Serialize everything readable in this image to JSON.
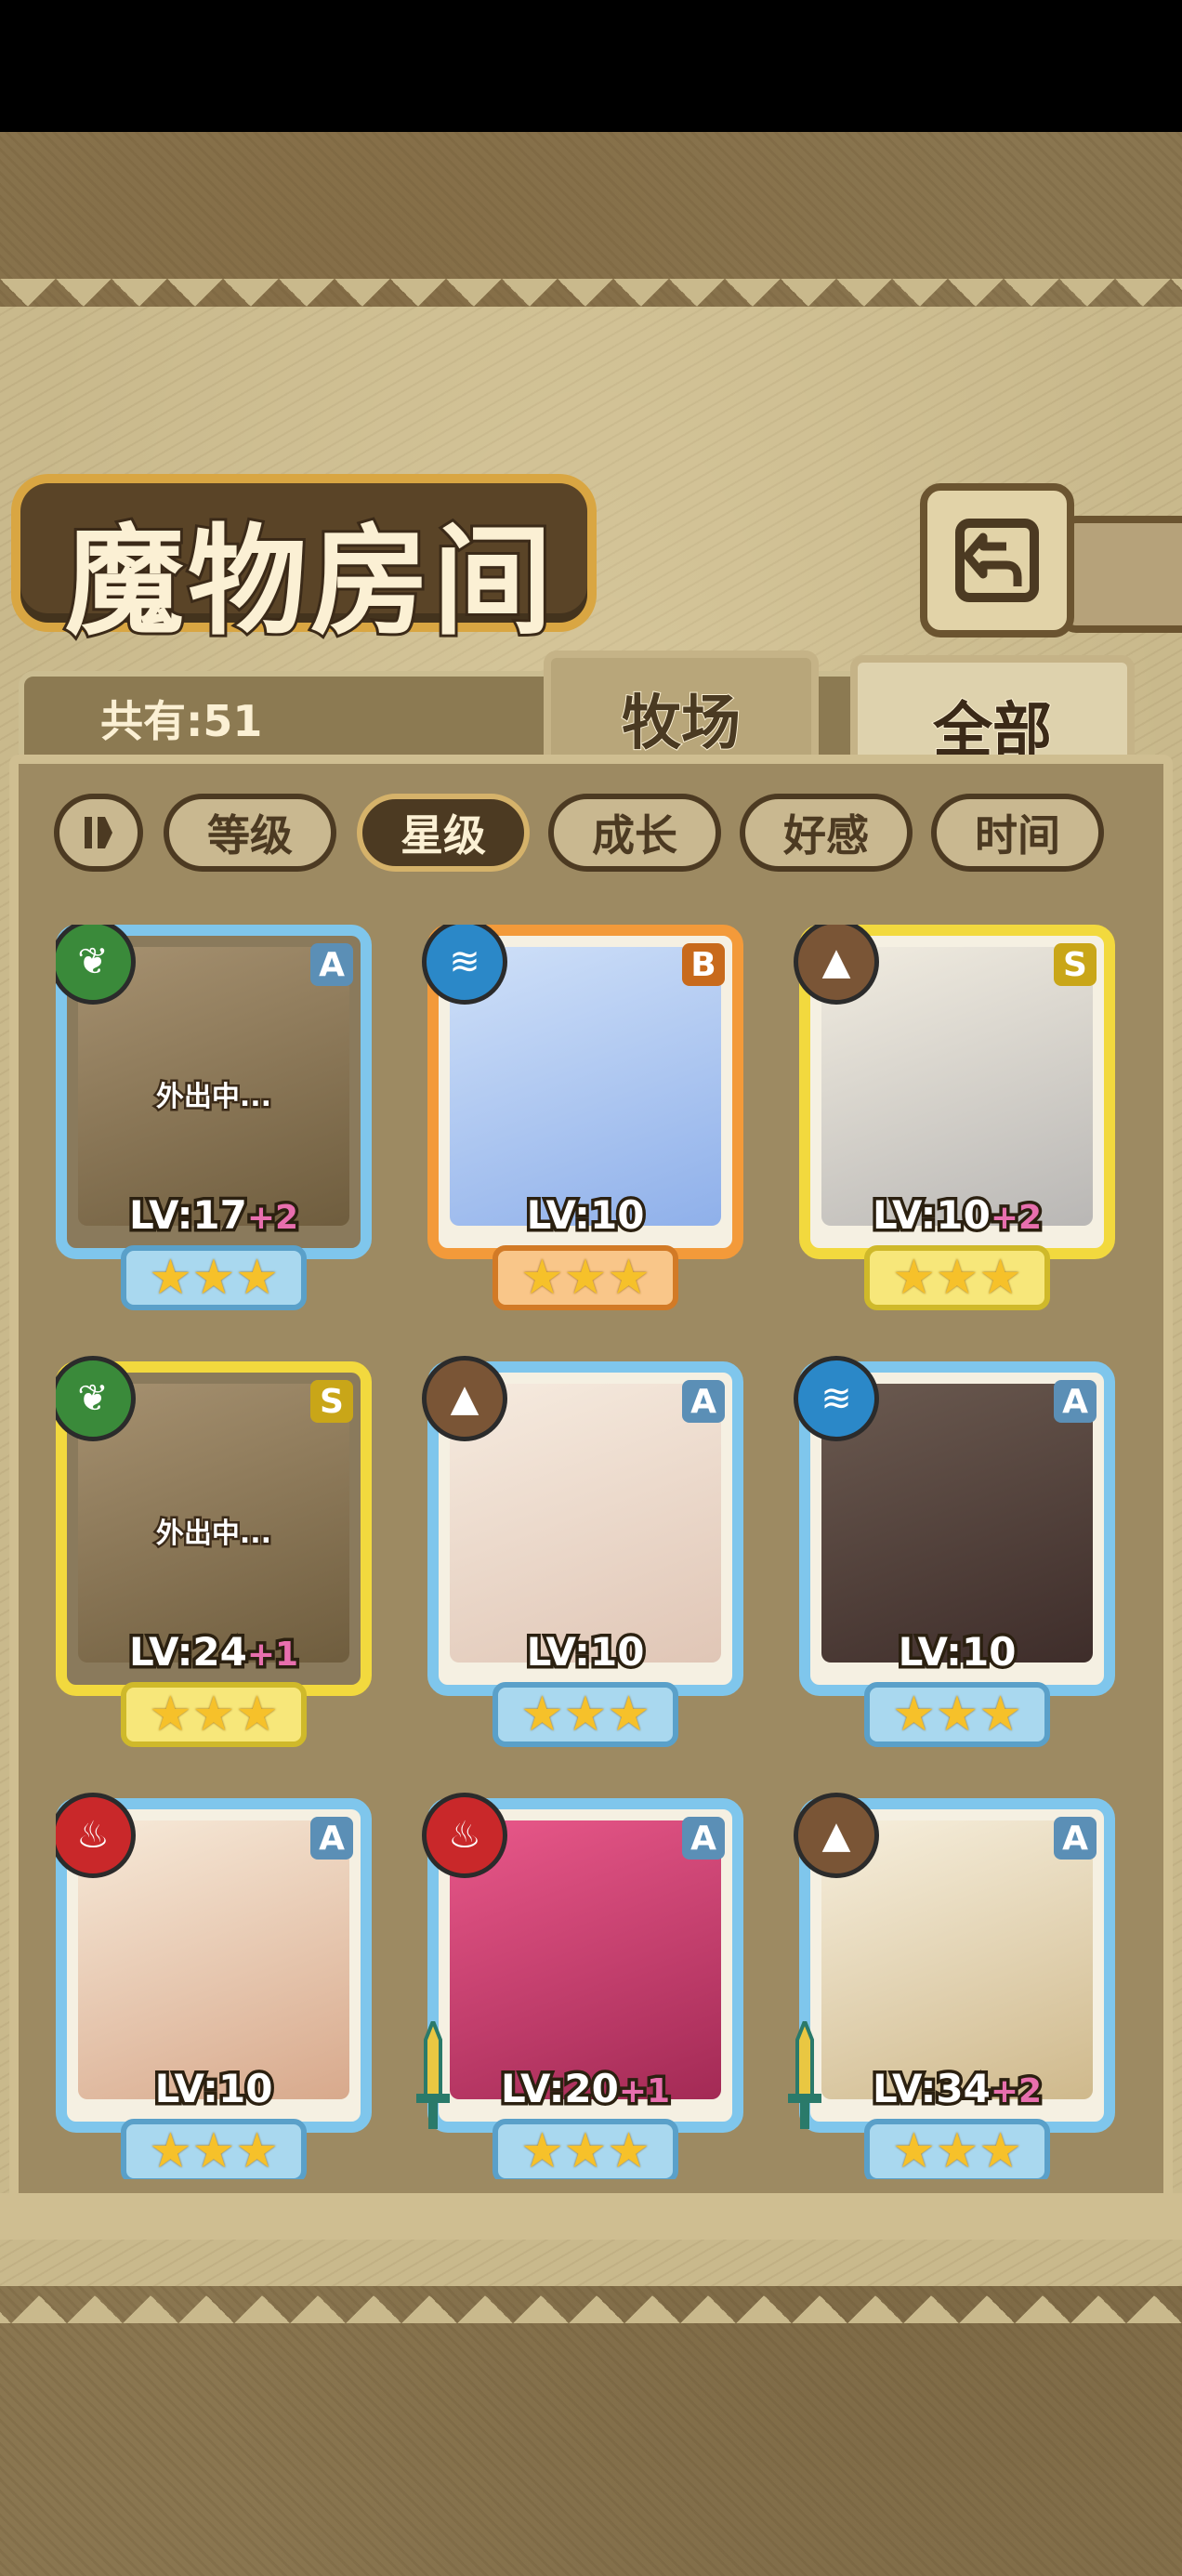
{
  "header": {
    "title": "魔物房间",
    "count_label": "共有:51"
  },
  "tabs": [
    {
      "label": "牧场"
    },
    {
      "label": "全部"
    }
  ],
  "sort_buttons": [
    {
      "label": "等级"
    },
    {
      "label": "星级"
    },
    {
      "label": "成长"
    },
    {
      "label": "好感"
    },
    {
      "label": "时间"
    }
  ],
  "active_sort": "星级",
  "colors": {
    "rank_A": "#7fc6ec",
    "rank_B": "#f39a3a",
    "rank_S": "#f2d93e",
    "level_bonus": "#e86fae"
  },
  "monsters": [
    {
      "element": "leaf",
      "rank": "A",
      "level": "LV:17",
      "bonus": "+2",
      "stars": "★★★",
      "status": "外出中..."
    },
    {
      "element": "water",
      "rank": "B",
      "level": "LV:10",
      "bonus": "",
      "stars": "★★★",
      "status": ""
    },
    {
      "element": "earth",
      "rank": "S",
      "level": "LV:10",
      "bonus": "+2",
      "stars": "★★★",
      "status": ""
    },
    {
      "element": "leaf",
      "rank": "S",
      "level": "LV:24",
      "bonus": "+1",
      "stars": "★★★",
      "status": "外出中..."
    },
    {
      "element": "earth",
      "rank": "A",
      "level": "LV:10",
      "bonus": "",
      "stars": "★★★",
      "status": ""
    },
    {
      "element": "water",
      "rank": "A",
      "level": "LV:10",
      "bonus": "",
      "stars": "★★★",
      "status": ""
    },
    {
      "element": "fire",
      "rank": "A",
      "level": "LV:10",
      "bonus": "",
      "stars": "★★★",
      "status": ""
    },
    {
      "element": "fire",
      "rank": "A",
      "level": "LV:20",
      "bonus": "+1",
      "stars": "★★★",
      "status": ""
    },
    {
      "element": "earth",
      "rank": "A",
      "level": "LV:34",
      "bonus": "+2",
      "stars": "★★★",
      "status": ""
    }
  ]
}
